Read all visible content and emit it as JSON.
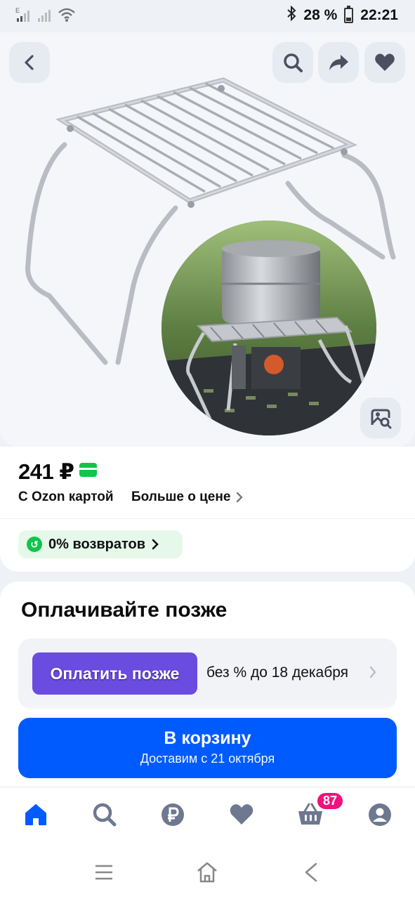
{
  "status_bar": {
    "network_type": "E",
    "battery_percent": "28 %",
    "time": "22:21",
    "icons": [
      "signal-icon",
      "signal-icon",
      "wifi-icon",
      "bluetooth-icon",
      "battery-icon"
    ]
  },
  "gallery": {
    "buttons": [
      "back-icon",
      "search-icon",
      "share-icon",
      "heart-icon",
      "image-search-icon"
    ]
  },
  "price": {
    "amount": "241 ₽",
    "ozon_card_label": "С Ozon картой",
    "more_label": "Больше о цене",
    "returns_label": "0% возвратов",
    "accent_color": "#10c44c"
  },
  "pay_later": {
    "title": "Оплачивайте позже",
    "button_label": "Оплатить позже",
    "terms": "без % до 18 декабря"
  },
  "cart": {
    "button_label": "В корзину",
    "delivery": "Доставим с 21 октября",
    "color": "#005bff"
  },
  "bottom_nav": {
    "items": [
      "home-icon",
      "search-icon",
      "ruble-icon",
      "heart-icon",
      "cart-icon",
      "profile-icon"
    ],
    "cart_badge": "87",
    "active_color": "#005bff"
  },
  "system_nav": {
    "items": [
      "recent-apps-icon",
      "home-icon",
      "back-icon"
    ]
  }
}
